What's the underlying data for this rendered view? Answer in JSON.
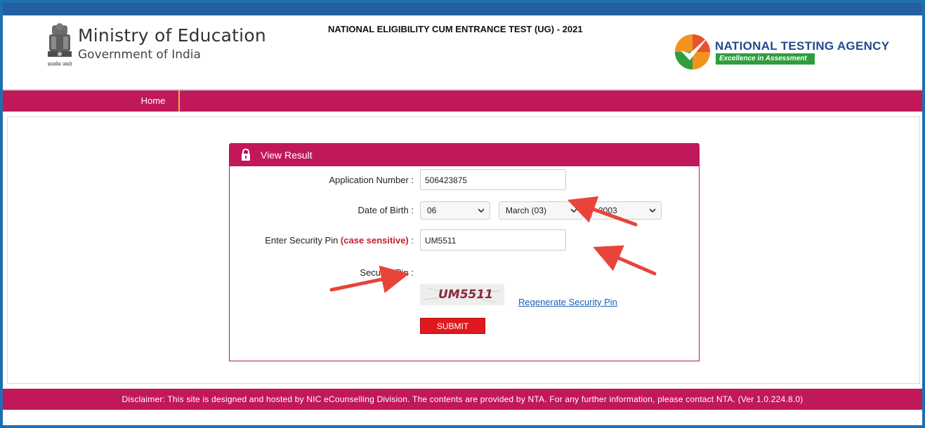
{
  "header": {
    "ministry": "Ministry of Education",
    "government": "Government of India",
    "emblem_motto": "सत्यमेव जयते",
    "exam_title": "NATIONAL ELIGIBILITY CUM ENTRANCE TEST (UG) - 2021",
    "agency_name": "NATIONAL TESTING AGENCY",
    "agency_tagline": "Excellence in Assessment"
  },
  "nav": {
    "home": "Home"
  },
  "panel": {
    "title": "View Result",
    "application_label": "Application Number :",
    "application_value": "506423875",
    "dob_label": "Date of Birth :",
    "dob_day": "06",
    "dob_month": "March (03)",
    "dob_year": "2003",
    "pin_label_prefix": "Enter Security Pin ",
    "pin_label_case": "(case sensitive)",
    "pin_label_suffix": " :",
    "pin_value": "UM5511",
    "security_pin_label": "Security Pin :",
    "captcha_text": "UM5511",
    "regenerate_label": "Regenerate Security Pin",
    "submit_label": "SUBMIT"
  },
  "footer": {
    "disclaimer": "Disclaimer: This site is designed and hosted by NIC eCounselling Division. The contents are provided by NTA. For any further information, please contact NTA. (Ver 1.0.224.8.0)"
  },
  "colors": {
    "brand_magenta": "#c1185a",
    "submit_red": "#e0191f",
    "link_blue": "#1a5fb4",
    "agency_blue": "#1f4b8e",
    "agency_green": "#2e9e3e",
    "annotation_red": "#e8443a"
  },
  "icons": {
    "lock": "lock-icon",
    "emblem": "national-emblem-icon",
    "agency_logo": "nta-check-logo-icon",
    "chevron": "chevron-down-icon"
  }
}
